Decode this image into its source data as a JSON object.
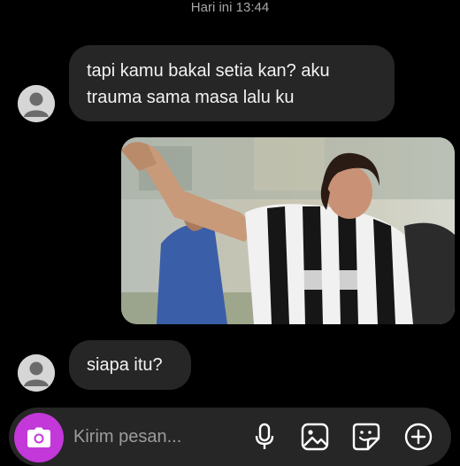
{
  "header": {
    "timestamp": "Hari ini 13:44"
  },
  "messages": [
    {
      "sender": "other",
      "text_line1": "tapi kamu bakal setia kan? aku",
      "text_line2": "trauma sama masa lalu ku"
    },
    {
      "sender": "other",
      "type": "image"
    },
    {
      "sender": "other",
      "text": "siapa itu?"
    }
  ],
  "composer": {
    "placeholder": "Kirim pesan...",
    "icons": [
      "camera-icon",
      "microphone-icon",
      "gallery-icon",
      "sticker-icon",
      "plus-icon"
    ]
  },
  "colors": {
    "background": "#000000",
    "bubble": "#262626",
    "camera_accent": "#c238d9"
  }
}
